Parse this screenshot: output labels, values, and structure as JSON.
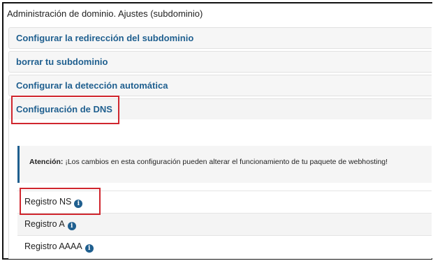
{
  "header": {
    "title": "Administración de dominio. Ajustes (subdominio)"
  },
  "accordion": {
    "items": [
      {
        "label": "Configurar la redirección del subdominio"
      },
      {
        "label": "borrar tu subdominio"
      },
      {
        "label": "Configurar la detección automática"
      },
      {
        "label": "Configuración de DNS"
      }
    ]
  },
  "notice": {
    "label": "Atención:",
    "text": "¡Los cambios en esta configuración pueden alterar el funcionamiento de tu paquete de webhosting!"
  },
  "records": [
    {
      "label": "Registro NS"
    },
    {
      "label": "Registro A"
    },
    {
      "label": "Registro AAAA"
    }
  ],
  "icons": {
    "info": "info-icon"
  },
  "colors": {
    "link": "#1f5f8f",
    "highlight": "#d0262e"
  }
}
